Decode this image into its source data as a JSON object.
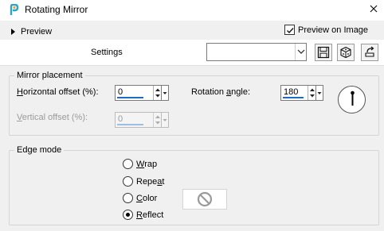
{
  "window": {
    "title": "Rotating Mirror",
    "close_icon": "close-icon"
  },
  "preview": {
    "label": "Preview",
    "preview_on_image_label": "Preview on Image",
    "preview_on_image_checked": true
  },
  "settings": {
    "label": "Settings",
    "preset_value": "",
    "buttons": [
      "save-icon",
      "randomize-icon",
      "reset-icon"
    ]
  },
  "mirror_placement": {
    "title": "Mirror placement",
    "horizontal_offset": {
      "label_pre": "",
      "label_key": "H",
      "label_post": "orizontal offset (%):",
      "value": "0"
    },
    "vertical_offset": {
      "label_pre": "",
      "label_key": "V",
      "label_post": "ertical offset (%):",
      "value": "0",
      "enabled": false
    },
    "rotation_angle": {
      "label_pre": "Rotation ",
      "label_key": "a",
      "label_post": "ngle:",
      "value": "180"
    }
  },
  "edge_mode": {
    "title": "Edge mode",
    "options": [
      {
        "key": "W",
        "rest": "rap",
        "selected": false
      },
      {
        "key": "",
        "rest": "Repeat",
        "selected": false,
        "prefix": "Repe",
        "key2": "a",
        "suffix": "t"
      },
      {
        "key": "C",
        "rest": "olor",
        "selected": false
      },
      {
        "key": "R",
        "rest": "eflect",
        "selected": true
      }
    ]
  },
  "colors": {
    "accent_underline": "#1c6cc4",
    "window_bg": "#f0f0f0"
  }
}
